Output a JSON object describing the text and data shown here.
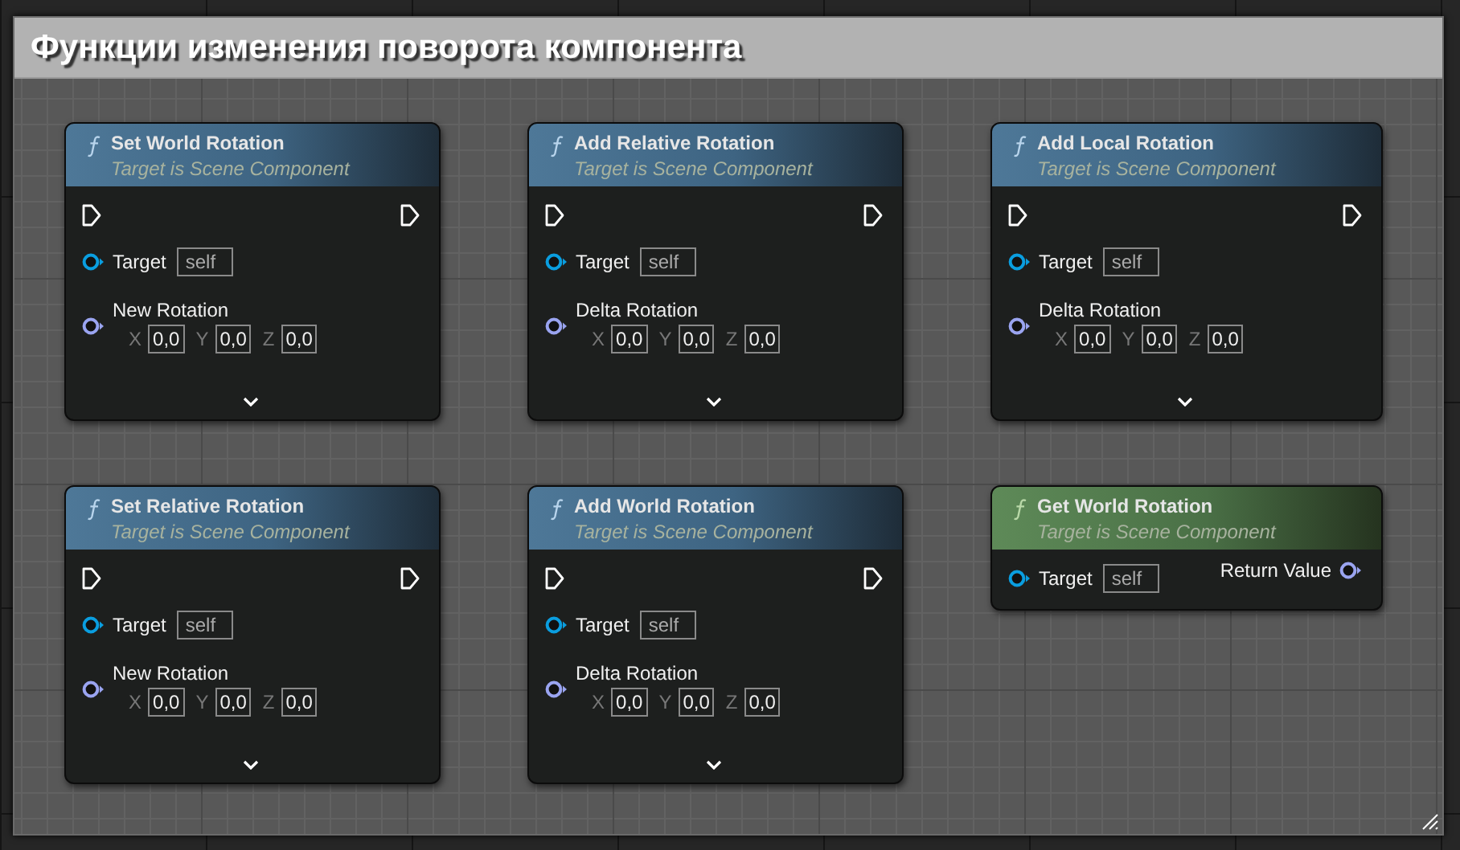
{
  "comment": {
    "title": "Функции изменения поворота компонента"
  },
  "nodes": [
    {
      "kind": "impure",
      "title": "Set World Rotation",
      "subtitle": "Target is Scene Component",
      "inputs": [
        {
          "kind": "object",
          "label": "Target",
          "value": "self"
        },
        {
          "kind": "rotator",
          "label": "New Rotation",
          "fields": [
            {
              "axis": "X",
              "value": "0,0"
            },
            {
              "axis": "Y",
              "value": "0,0"
            },
            {
              "axis": "Z",
              "value": "0,0"
            }
          ]
        }
      ],
      "advanced_collapsed": true
    },
    {
      "kind": "impure",
      "title": "Add Relative Rotation",
      "subtitle": "Target is Scene Component",
      "inputs": [
        {
          "kind": "object",
          "label": "Target",
          "value": "self"
        },
        {
          "kind": "rotator",
          "label": "Delta Rotation",
          "fields": [
            {
              "axis": "X",
              "value": "0,0"
            },
            {
              "axis": "Y",
              "value": "0,0"
            },
            {
              "axis": "Z",
              "value": "0,0"
            }
          ]
        }
      ],
      "advanced_collapsed": true
    },
    {
      "kind": "impure",
      "title": "Add Local Rotation",
      "subtitle": "Target is Scene Component",
      "inputs": [
        {
          "kind": "object",
          "label": "Target",
          "value": "self"
        },
        {
          "kind": "rotator",
          "label": "Delta Rotation",
          "fields": [
            {
              "axis": "X",
              "value": "0,0"
            },
            {
              "axis": "Y",
              "value": "0,0"
            },
            {
              "axis": "Z",
              "value": "0,0"
            }
          ]
        }
      ],
      "advanced_collapsed": true
    },
    {
      "kind": "impure",
      "title": "Set Relative Rotation",
      "subtitle": "Target is Scene Component",
      "inputs": [
        {
          "kind": "object",
          "label": "Target",
          "value": "self"
        },
        {
          "kind": "rotator",
          "label": "New Rotation",
          "fields": [
            {
              "axis": "X",
              "value": "0,0"
            },
            {
              "axis": "Y",
              "value": "0,0"
            },
            {
              "axis": "Z",
              "value": "0,0"
            }
          ]
        }
      ],
      "advanced_collapsed": true
    },
    {
      "kind": "impure",
      "title": "Add World Rotation",
      "subtitle": "Target is Scene Component",
      "inputs": [
        {
          "kind": "object",
          "label": "Target",
          "value": "self"
        },
        {
          "kind": "rotator",
          "label": "Delta Rotation",
          "fields": [
            {
              "axis": "X",
              "value": "0,0"
            },
            {
              "axis": "Y",
              "value": "0,0"
            },
            {
              "axis": "Z",
              "value": "0,0"
            }
          ]
        }
      ],
      "advanced_collapsed": true
    },
    {
      "kind": "pure",
      "title": "Get World Rotation",
      "subtitle": "Target is Scene Component",
      "inputs": [
        {
          "kind": "object",
          "label": "Target",
          "value": "self"
        }
      ],
      "outputs": [
        {
          "kind": "rotator",
          "label": "Return Value"
        }
      ]
    }
  ]
}
